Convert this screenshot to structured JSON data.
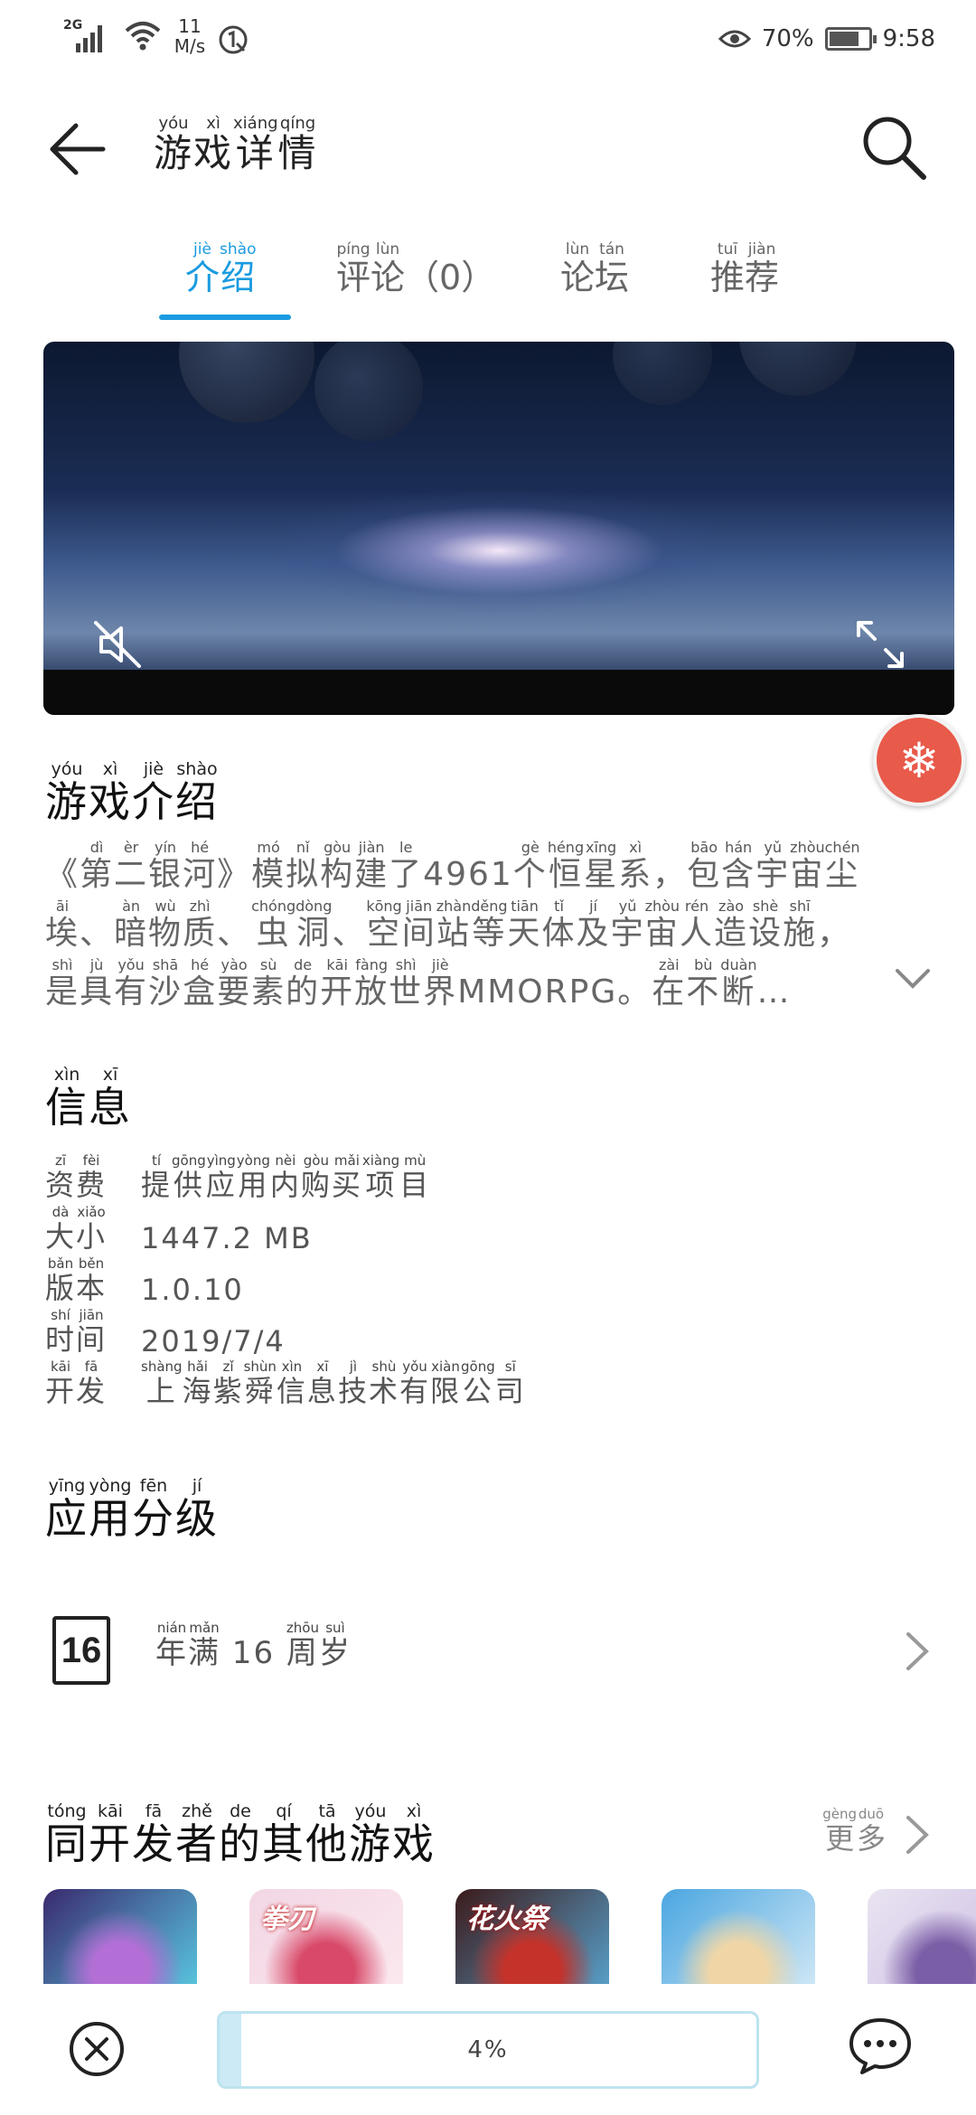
{
  "status_bar": {
    "signal": "2G",
    "net_speed_value": "11",
    "net_speed_unit": "M/s",
    "battery_percent": "70%",
    "battery_level": 0.7,
    "time": "9:58"
  },
  "header": {
    "title": [
      "游",
      "戏",
      "详",
      "情"
    ],
    "title_pinyin": [
      "yóu",
      "xì",
      "xiáng",
      "qíng"
    ]
  },
  "tabs": [
    {
      "chars": [
        "介",
        "绍"
      ],
      "pinyin": [
        "jiè",
        "shào"
      ],
      "active": true
    },
    {
      "chars": [
        "评",
        "论"
      ],
      "pinyin": [
        "píng",
        "lùn"
      ],
      "suffix": "（0）",
      "active": false
    },
    {
      "chars": [
        "论",
        "坛"
      ],
      "pinyin": [
        "lùn",
        "tán"
      ],
      "active": false
    },
    {
      "chars": [
        "推",
        "荐"
      ],
      "pinyin": [
        "tuī",
        "jiàn"
      ],
      "active": false
    }
  ],
  "intro_section": {
    "title": [
      "游",
      "戏",
      "介",
      "绍"
    ],
    "title_pinyin": [
      "yóu",
      "xì",
      "jiè",
      "shào"
    ],
    "lines": [
      [
        [
          "《",
          ""
        ],
        [
          "第",
          "dì"
        ],
        [
          "二",
          "èr"
        ],
        [
          "银",
          "yín"
        ],
        [
          "河",
          "hé"
        ],
        [
          "》",
          ""
        ],
        [
          "模",
          "mó"
        ],
        [
          "拟",
          "nǐ"
        ],
        [
          "构",
          "gòu"
        ],
        [
          "建",
          "jiàn"
        ],
        [
          "了",
          "le"
        ],
        [
          "4961",
          ""
        ],
        [
          "个",
          "gè"
        ],
        [
          "恒",
          "héng"
        ],
        [
          "星",
          "xīng"
        ],
        [
          "系",
          "xì"
        ],
        [
          "，",
          ""
        ],
        [
          "包",
          "bāo"
        ],
        [
          "含",
          "hán"
        ],
        [
          "宇",
          "yǔ"
        ],
        [
          "宙",
          "zhòu"
        ],
        [
          "尘",
          "chén"
        ]
      ],
      [
        [
          "埃",
          "āi"
        ],
        [
          "、",
          ""
        ],
        [
          "暗",
          "àn"
        ],
        [
          "物",
          "wù"
        ],
        [
          "质",
          "zhì"
        ],
        [
          "、",
          ""
        ],
        [
          "虫",
          "chóng"
        ],
        [
          "洞",
          "dòng"
        ],
        [
          "、",
          ""
        ],
        [
          "空",
          "kōng"
        ],
        [
          "间",
          "jiān"
        ],
        [
          "站",
          "zhàn"
        ],
        [
          "等",
          "děng"
        ],
        [
          "天",
          "tiān"
        ],
        [
          "体",
          "tǐ"
        ],
        [
          "及",
          "jí"
        ],
        [
          "宇",
          "yǔ"
        ],
        [
          "宙",
          "zhòu"
        ],
        [
          "人",
          "rén"
        ],
        [
          "造",
          "zào"
        ],
        [
          "设",
          "shè"
        ],
        [
          "施",
          "shī"
        ],
        [
          "，",
          ""
        ]
      ],
      [
        [
          "是",
          "shì"
        ],
        [
          "具",
          "jù"
        ],
        [
          "有",
          "yǒu"
        ],
        [
          "沙",
          "shā"
        ],
        [
          "盒",
          "hé"
        ],
        [
          "要",
          "yào"
        ],
        [
          "素",
          "sù"
        ],
        [
          "的",
          "de"
        ],
        [
          "开",
          "kāi"
        ],
        [
          "放",
          "fàng"
        ],
        [
          "世",
          "shì"
        ],
        [
          "界",
          "jiè"
        ],
        [
          "MMORPG。",
          ""
        ],
        [
          "在",
          "zài"
        ],
        [
          "不",
          "bù"
        ],
        [
          "断",
          "duàn"
        ],
        [
          "…",
          ""
        ]
      ]
    ]
  },
  "info_section": {
    "title": [
      "信",
      "息"
    ],
    "title_pinyin": [
      "xìn",
      "xī"
    ],
    "rows": [
      {
        "label": [
          [
            "资",
            "zī"
          ],
          [
            "费",
            "fèi"
          ]
        ],
        "value": [
          [
            "提",
            "tí"
          ],
          [
            "供",
            "gōng"
          ],
          [
            "应",
            "yìng"
          ],
          [
            "用",
            "yòng"
          ],
          [
            "内",
            "nèi"
          ],
          [
            "购",
            "gòu"
          ],
          [
            "买",
            "mǎi"
          ],
          [
            "项",
            "xiàng"
          ],
          [
            "目",
            "mù"
          ]
        ]
      },
      {
        "label": [
          [
            "大",
            "dà"
          ],
          [
            "小",
            "xiǎo"
          ]
        ],
        "value": [
          [
            "1447.2 MB",
            ""
          ]
        ]
      },
      {
        "label": [
          [
            "版",
            "bǎn"
          ],
          [
            "本",
            "běn"
          ]
        ],
        "value": [
          [
            "1.0.10",
            ""
          ]
        ]
      },
      {
        "label": [
          [
            "时",
            "shí"
          ],
          [
            "间",
            "jiān"
          ]
        ],
        "value": [
          [
            "2019/7/4",
            ""
          ]
        ]
      },
      {
        "label": [
          [
            "开",
            "kāi"
          ],
          [
            "发",
            "fā"
          ]
        ],
        "value": [
          [
            "上",
            "shàng"
          ],
          [
            "海",
            "hǎi"
          ],
          [
            "紫",
            "zǐ"
          ],
          [
            "舜",
            "shùn"
          ],
          [
            "信",
            "xìn"
          ],
          [
            "息",
            "xī"
          ],
          [
            "技",
            "jì"
          ],
          [
            "术",
            "shù"
          ],
          [
            "有",
            "yǒu"
          ],
          [
            "限",
            "xiàn"
          ],
          [
            "公",
            "gōng"
          ],
          [
            "司",
            "sī"
          ]
        ]
      }
    ]
  },
  "rating_section": {
    "title": [
      "应",
      "用",
      "分",
      "级"
    ],
    "title_pinyin": [
      "yīng",
      "yòng",
      "fēn",
      "jí"
    ],
    "badge": "16",
    "text": [
      [
        "年",
        "nián"
      ],
      [
        "满",
        "mǎn"
      ],
      [
        " 16 ",
        ""
      ],
      [
        "周",
        "zhōu"
      ],
      [
        "岁",
        "suì"
      ]
    ]
  },
  "same_dev_section": {
    "title": [
      "同",
      "开",
      "发",
      "者",
      "的",
      "其",
      "他",
      "游",
      "戏"
    ],
    "title_pinyin": [
      "tóng",
      "kāi",
      "fā",
      "zhě",
      "de",
      "qí",
      "tā",
      "yóu",
      "xì"
    ],
    "more": [
      [
        "更",
        "gèng"
      ],
      [
        "多",
        "duō"
      ]
    ],
    "games": [
      {
        "colors": [
          "#3a2a6e",
          "#b36fd6",
          "#5ad0e6"
        ],
        "label": ""
      },
      {
        "colors": [
          "#f2d6e4",
          "#d94a6a",
          "#fce9ef"
        ],
        "label": "拳刃"
      },
      {
        "colors": [
          "#3b1a1a",
          "#c4322a",
          "#5aa9d6"
        ],
        "label": "花火祭"
      },
      {
        "colors": [
          "#4aa6e0",
          "#f0d6a6",
          "#d9ecf7"
        ],
        "label": ""
      },
      {
        "colors": [
          "#e9e4f2",
          "#7a5ea6",
          "#c9b8e0"
        ],
        "label": ""
      }
    ]
  },
  "bottom_bar": {
    "progress_text": "4%",
    "progress_fraction": 0.04
  },
  "colors": {
    "accent": "#1a9be0",
    "fab": "#e85a4a",
    "progress_fill": "#cbeaf5"
  }
}
